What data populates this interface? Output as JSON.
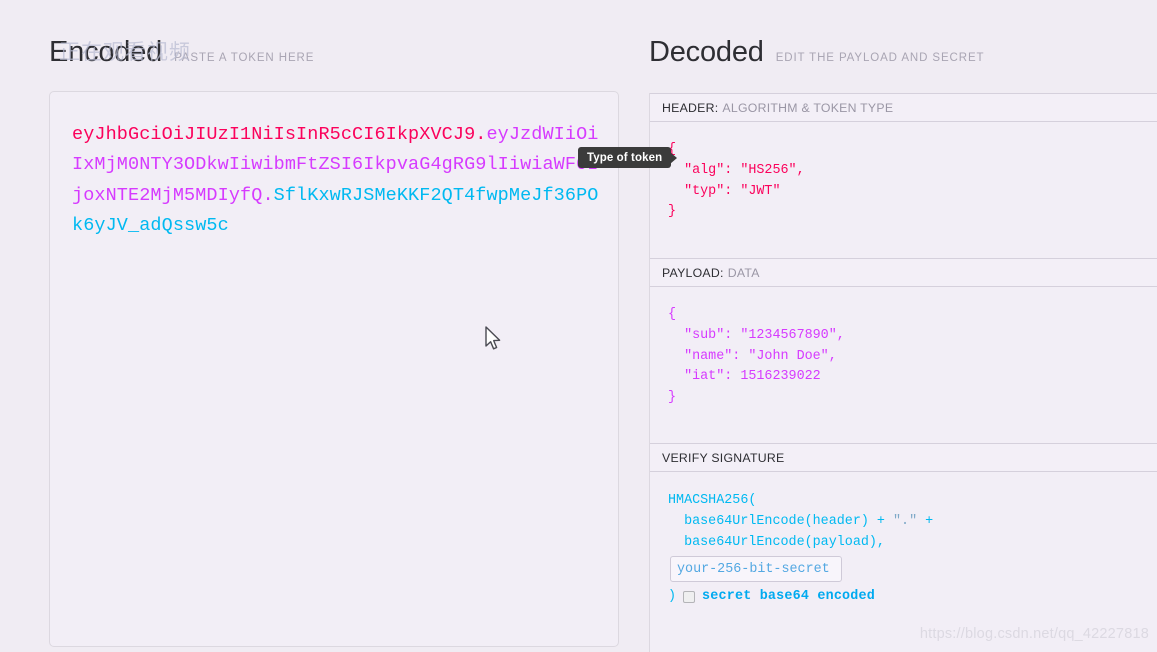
{
  "encoded": {
    "title": "Encoded",
    "subtitle": "PASTE A TOKEN HERE",
    "token": {
      "header": "eyJhbGciOiJIUzI1NiIsInR5cCI6IkpXVCJ9",
      "payload": "eyJzdWIiOiIxMjM0NTY3ODkwIiwibmFtZSI6IkpvaG4gRG9lIiwiaWF0IjoxNTE2MjM5MDIyfQ",
      "signature": "SflKxwRJSMeKKF2QT4fwpMeJf36POk6yJV_adQssw5c",
      "separator": "."
    },
    "colors": {
      "header": "#fb015b",
      "payload": "#d63aff",
      "signature": "#00b9f1"
    }
  },
  "tooltip": {
    "text": "Type of token"
  },
  "decoded": {
    "title": "Decoded",
    "subtitle": "EDIT THE PAYLOAD AND SECRET",
    "sections": [
      {
        "bar_strong": "HEADER:",
        "bar_light": "ALGORITHM & TOKEN TYPE",
        "body": "{\n  \"alg\": \"HS256\",\n  \"typ\": \"JWT\"\n}"
      },
      {
        "bar_strong": "PAYLOAD:",
        "bar_light": "DATA",
        "body": "{\n  \"sub\": \"1234567890\",\n  \"name\": \"John Doe\",\n  \"iat\": 1516239022\n}"
      },
      {
        "bar_strong": "VERIFY SIGNATURE",
        "bar_light": "",
        "body": ""
      }
    ],
    "verify": {
      "line1": "HMACSHA256(",
      "line2_a": "  base64UrlEncode(header) + ",
      "line2_b": "\".\"",
      "line2_c": " +",
      "line3": "  base64UrlEncode(payload),",
      "secret_value": "your-256-bit-secret",
      "paren_close": ")",
      "base64_label": "secret base64 encoded",
      "base64_checked": false
    }
  },
  "watermarks": {
    "top": "正在观看视频",
    "bottom": "https://blog.csdn.net/qq_42227818"
  },
  "cursor": {
    "icon": "arrow-pointer"
  }
}
